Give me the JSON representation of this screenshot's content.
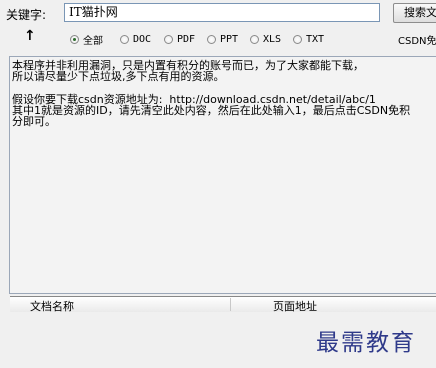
{
  "search": {
    "label": "关键字:",
    "value": "IT猫扑网",
    "button": "搜索文件"
  },
  "filters": {
    "up_icon": "up-arrow-icon",
    "options": [
      {
        "label": "全部",
        "selected": true
      },
      {
        "label": "DOC",
        "selected": false
      },
      {
        "label": "PDF",
        "selected": false
      },
      {
        "label": "PPT",
        "selected": false
      },
      {
        "label": "XLS",
        "selected": false
      },
      {
        "label": "TXT",
        "selected": false
      }
    ],
    "csdn": "CSDN免积分"
  },
  "info": {
    "line1": "本程序并非利用漏洞，只是内置有积分的账号而已，为了大家都能下载，",
    "line2": "所以请尽量少下点垃圾,多下点有用的资源。",
    "line3": "假设你要下载csdn资源地址为:  http://download.csdn.net/detail/abc/1",
    "line4": "其中1就是资源的ID，请先清空此处内容，然后在此处输入1，最后点击CSDN免积",
    "line5": "分即可。"
  },
  "list": {
    "col_name": "文档名称",
    "col_url": "页面地址"
  },
  "watermark": "最需教育"
}
